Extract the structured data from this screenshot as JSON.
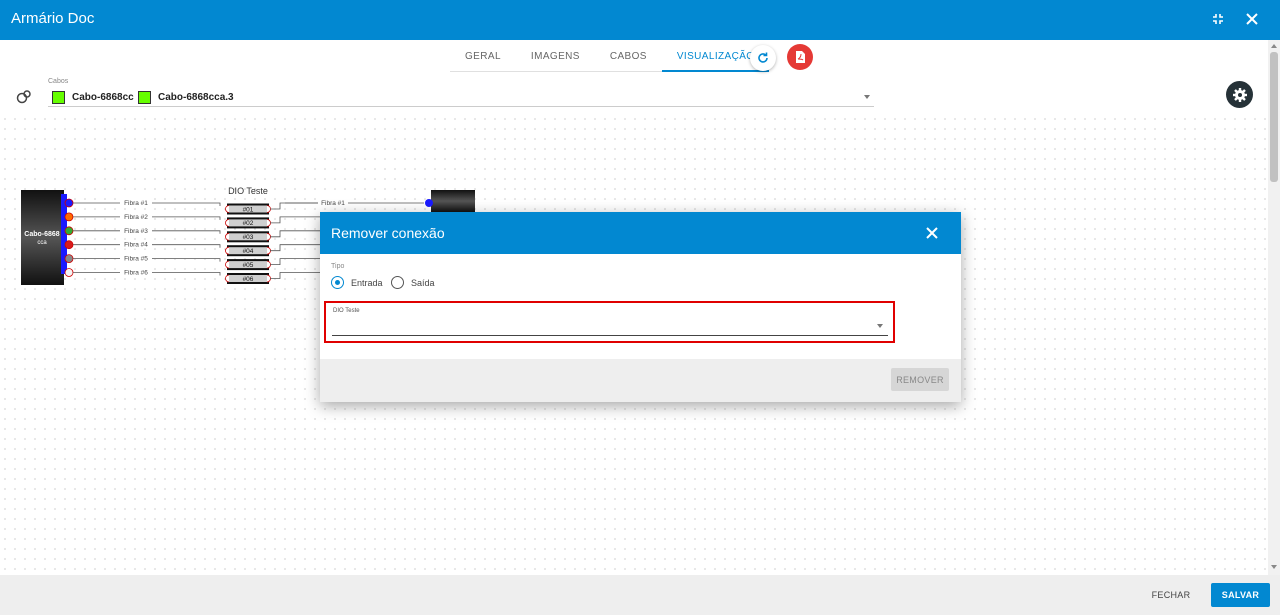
{
  "window": {
    "title": "Armário Doc"
  },
  "tabs": [
    {
      "label": "GERAL"
    },
    {
      "label": "IMAGENS"
    },
    {
      "label": "CABOS"
    },
    {
      "label": "VISUALIZAÇÃO",
      "active": true
    }
  ],
  "cabos": {
    "label": "Cabos",
    "chips": [
      {
        "label": "Cabo-6868cca"
      },
      {
        "label": "Cabo-6868cca.3"
      }
    ]
  },
  "diagram": {
    "left_cable_label_line1": "Cabo-6868",
    "left_cable_label_line2": "cca",
    "dio_title": "DIO Teste",
    "fibers": [
      "Fibra #1",
      "Fibra #2",
      "Fibra #3",
      "Fibra #4",
      "Fibra #5",
      "Fibra #6"
    ],
    "ports": [
      "#01",
      "#02",
      "#03",
      "#04",
      "#05",
      "#06"
    ],
    "right_fiber_label": "Fibra #1",
    "fiber_colors": [
      "#1a1aff",
      "#ff6a00",
      "#33aa33",
      "#d81b1b",
      "#888888",
      "#f5f5f5"
    ]
  },
  "modal": {
    "title": "Remover conexão",
    "tipo_label": "Tipo",
    "options": [
      {
        "label": "Entrada",
        "checked": true
      },
      {
        "label": "Saída",
        "checked": false
      }
    ],
    "dio_label": "DIO Teste",
    "remover_label": "REMOVER"
  },
  "footer": {
    "fechar_label": "FECHAR",
    "salvar_label": "SALVAR"
  },
  "colors": {
    "primary": "#0288d1",
    "danger": "#e53935",
    "highlight": "#e00000"
  }
}
